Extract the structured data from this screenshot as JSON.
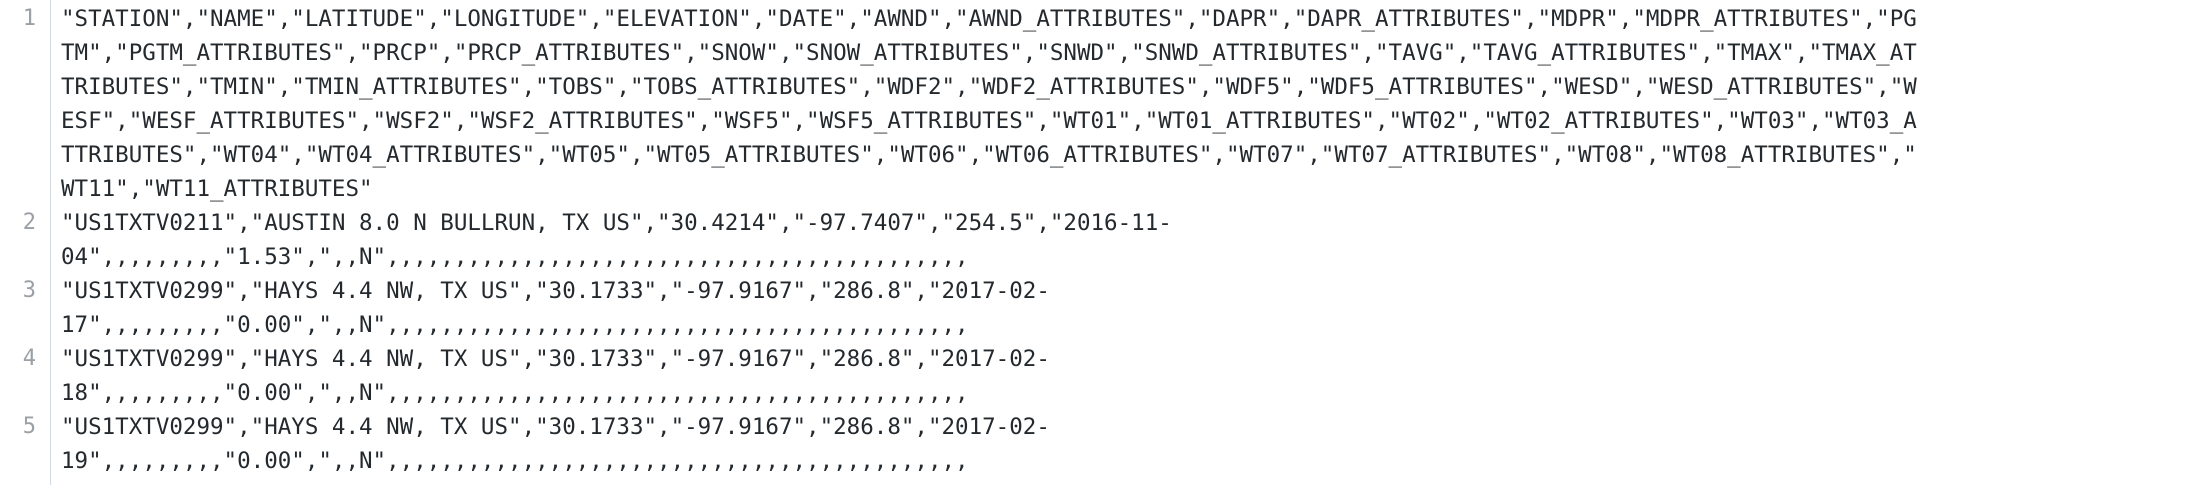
{
  "file": {
    "line_numbers": [
      "1",
      "2",
      "3",
      "4",
      "5"
    ],
    "visual_lines": [
      "\"STATION\",\"NAME\",\"LATITUDE\",\"LONGITUDE\",\"ELEVATION\",\"DATE\",\"AWND\",\"AWND_ATTRIBUTES\",\"DAPR\",\"DAPR_ATTRIBUTES\",\"MDPR\",\"MDPR_ATTRIBUTES\",\"PG",
      "TM\",\"PGTM_ATTRIBUTES\",\"PRCP\",\"PRCP_ATTRIBUTES\",\"SNOW\",\"SNOW_ATTRIBUTES\",\"SNWD\",\"SNWD_ATTRIBUTES\",\"TAVG\",\"TAVG_ATTRIBUTES\",\"TMAX\",\"TMAX_AT",
      "TRIBUTES\",\"TMIN\",\"TMIN_ATTRIBUTES\",\"TOBS\",\"TOBS_ATTRIBUTES\",\"WDF2\",\"WDF2_ATTRIBUTES\",\"WDF5\",\"WDF5_ATTRIBUTES\",\"WESD\",\"WESD_ATTRIBUTES\",\"W",
      "ESF\",\"WESF_ATTRIBUTES\",\"WSF2\",\"WSF2_ATTRIBUTES\",\"WSF5\",\"WSF5_ATTRIBUTES\",\"WT01\",\"WT01_ATTRIBUTES\",\"WT02\",\"WT02_ATTRIBUTES\",\"WT03\",\"WT03_A",
      "TTRIBUTES\",\"WT04\",\"WT04_ATTRIBUTES\",\"WT05\",\"WT05_ATTRIBUTES\",\"WT06\",\"WT06_ATTRIBUTES\",\"WT07\",\"WT07_ATTRIBUTES\",\"WT08\",\"WT08_ATTRIBUTES\",\"",
      "WT11\",\"WT11_ATTRIBUTES\"",
      "\"US1TXTV0211\",\"AUSTIN 8.0 N BULLRUN, TX US\",\"30.4214\",\"-97.7407\",\"254.5\",\"2016-11-",
      "04\",,,,,,,,,\"1.53\",\",,N\",,,,,,,,,,,,,,,,,,,,,,,,,,,,,,,,,,,,,,,,,,,",
      "\"US1TXTV0299\",\"HAYS 4.4 NW, TX US\",\"30.1733\",\"-97.9167\",\"286.8\",\"2017-02-",
      "17\",,,,,,,,,\"0.00\",\",,N\",,,,,,,,,,,,,,,,,,,,,,,,,,,,,,,,,,,,,,,,,,,",
      "\"US1TXTV0299\",\"HAYS 4.4 NW, TX US\",\"30.1733\",\"-97.9167\",\"286.8\",\"2017-02-",
      "18\",,,,,,,,,\"0.00\",\",,N\",,,,,,,,,,,,,,,,,,,,,,,,,,,,,,,,,,,,,,,,,,,",
      "\"US1TXTV0299\",\"HAYS 4.4 NW, TX US\",\"30.1733\",\"-97.9167\",\"286.8\",\"2017-02-",
      "19\",,,,,,,,,\"0.00\",\",,N\",,,,,,,,,,,,,,,,,,,,,,,,,,,,,,,,,,,,,,,,,,,"
    ]
  }
}
